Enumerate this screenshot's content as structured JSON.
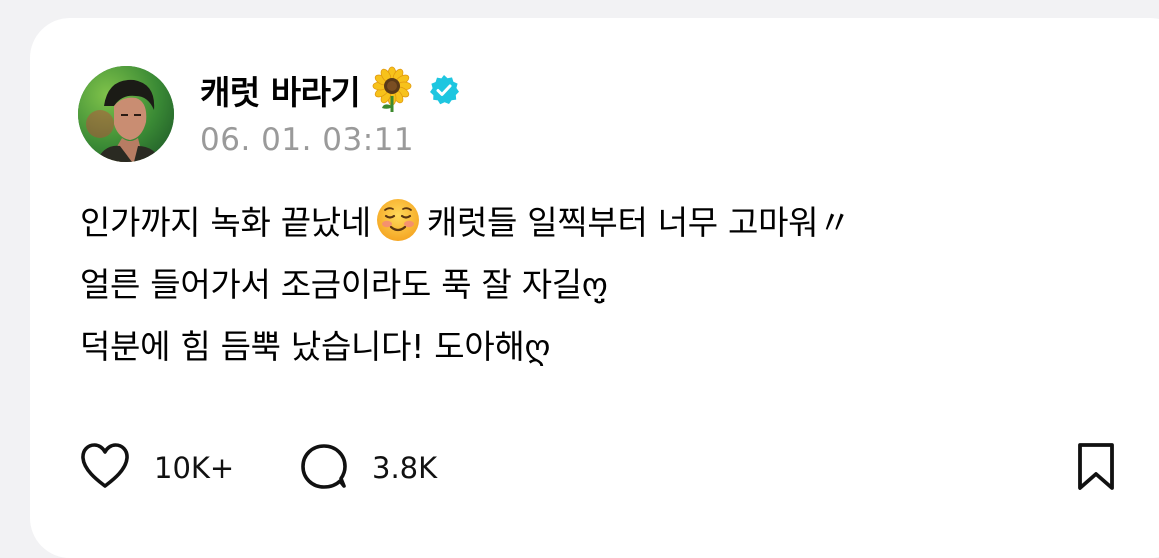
{
  "post": {
    "author": {
      "name": "캐럿 바라기",
      "avatar_icon": "profile-photo",
      "name_emoji_icon": "sunflower-icon",
      "verified_icon": "verified-badge-icon",
      "verified_color": "#1ec6e0"
    },
    "timestamp": "06. 01. 03:11",
    "body": {
      "line1_part1": "인가까지 녹화 끝났네",
      "line1_emoji_icon": "smiling-face-icon",
      "line1_part2": "캐럿들 일찍부터 너무 고마워〃",
      "line2": "얼른 들어가서 조금이라도 푹 잘 자길ო̤̮",
      "line3": "덕분에 힘 듬뿍 났습니다! 도아해ღ"
    },
    "actions": {
      "like_icon": "heart-icon",
      "like_count": "10K+",
      "reply_icon": "comment-bubble-icon",
      "reply_count": "3.8K",
      "bookmark_icon": "bookmark-icon"
    }
  }
}
